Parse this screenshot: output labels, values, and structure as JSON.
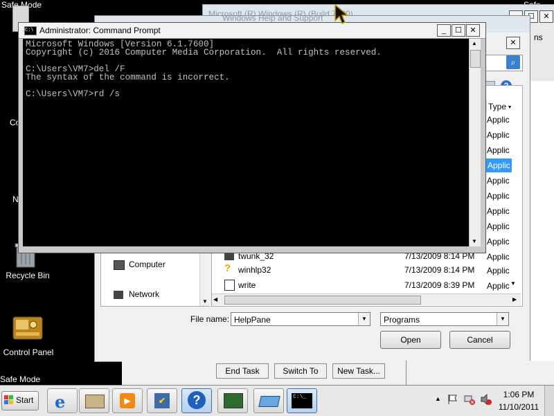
{
  "desktop": {
    "safe_mode_top_left": "Safe Mode",
    "safe_mode_top_right": "Safe Mod",
    "safe_mode_bottom_left": "Safe Mode",
    "icons": {
      "computer_partial": "Co",
      "network_partial": "N",
      "recycle_bin": "Recycle Bin",
      "control_panel": "Control Panel"
    }
  },
  "help_window": {
    "title": "Windows Help and Support",
    "behind_title": "Microsoft (R) Windows (R) (Build 7600)",
    "partial_ns": "ns"
  },
  "open_dialog": {
    "nav": {
      "computer": "Computer",
      "network": "Network"
    },
    "column_type": "Type",
    "type_rows": [
      "Applic",
      "Applic",
      "Applic",
      "Applic",
      "Applic",
      "Applic",
      "Applic",
      "Applic",
      "Applic"
    ],
    "files": [
      {
        "name": "twunk_32",
        "date": "7/13/2009 8:14 PM",
        "type": "Applic"
      },
      {
        "name": "winhlp32",
        "date": "7/13/2009 8:14 PM",
        "type": "Applic"
      },
      {
        "name": "write",
        "date": "7/13/2009 8:39 PM",
        "type": "Applic"
      }
    ],
    "file_name_label": "File name:",
    "file_name_value": "HelpPane",
    "file_type_value": "Programs",
    "open_label": "Open",
    "cancel_label": "Cancel"
  },
  "cmd": {
    "title": "Administrator: Command Prompt",
    "lines": [
      "Microsoft Windows [Version 6.1.7600]",
      "Copyright (c) 2016 Computer Media Corporation.  All rights reserved.",
      "",
      "C:\\Users\\VM7>del /F",
      "The syntax of the command is incorrect.",
      "",
      "C:\\Users\\VM7>rd /s"
    ]
  },
  "task_manager_buttons": {
    "end_task": "End Task",
    "switch_to": "Switch To",
    "new_task": "New Task..."
  },
  "taskbar": {
    "start_label": "Start",
    "time": "1:06 PM",
    "date": "11/10/2011",
    "cmd_thumb": "C:\\_"
  }
}
